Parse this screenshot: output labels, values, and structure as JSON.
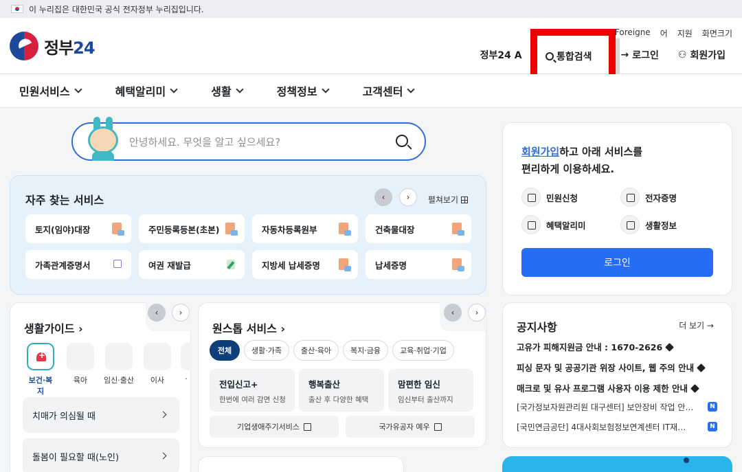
{
  "gov_banner": {
    "text": "이 누리집은 대한민국 공식 전자정부 누리집입니다."
  },
  "header": {
    "logo_prefix": "정부",
    "logo_num": "24",
    "util_top": [
      "For Foreigne",
      "어",
      "지원",
      "화면크기"
    ],
    "util_main": {
      "gov24": "정부24 A",
      "search": "통합검색",
      "login": "로그인",
      "signup": "회원가입"
    }
  },
  "nav": {
    "items": [
      "민원서비스",
      "혜택알리미",
      "생활",
      "정책정보",
      "고객센터"
    ]
  },
  "search": {
    "placeholder": "안녕하세요. 무엇을 알고 싶으세요?"
  },
  "frequent": {
    "title": "자주 찾는 서비스",
    "expand": "펼쳐보기",
    "items": [
      "토지(임야)대장",
      "주민등록등본(초본)",
      "자동차등록원부",
      "건축물대장",
      "가족관계증명서",
      "여권 재발급",
      "지방세 납세증명",
      "납세증명"
    ]
  },
  "life_guide": {
    "title": "생활가이드",
    "categories": [
      "보건·복지",
      "육아",
      "임신·출산",
      "이사",
      "·"
    ],
    "items": [
      "치매가 의심될 때",
      "돌봄이 필요할 때(노인)"
    ]
  },
  "onestop": {
    "title": "원스톱 서비스",
    "chips": [
      "전체",
      "생활·가족",
      "출산·육아",
      "복지·금융",
      "교육·취업·기업"
    ],
    "cards": [
      {
        "title": "전입신고+",
        "sub": "한번에 여러 감면 신청"
      },
      {
        "title": "행복출산",
        "sub": "출산 후 다양한 혜택"
      },
      {
        "title": "맘편한 임신",
        "sub": "임신부터 출산까지"
      }
    ],
    "links": [
      "기업생애주기서비스",
      "국가유공자 예우"
    ]
  },
  "login_card": {
    "link": "회원가입",
    "msg1": "하고 아래 서비스를",
    "msg2": "편리하게 이용하세요.",
    "quick": [
      "민원신청",
      "전자증명",
      "혜택알리미",
      "생활정보"
    ],
    "button": "로그인"
  },
  "notice": {
    "title": "공지사항",
    "more": "더 보기 →",
    "items": [
      "고유가 피해지원금 안내 : 1670-2626",
      "피싱 문자 및 공공기관 위장 사이트, 웹 주의 안내",
      "매크로 및 유사 프로그램 사용자 이용 제한 안내",
      "[국가정보자원관리원 대구센터] 보안장비 작업 안…",
      "[국민연금공단] 4대사회보험정보연계센터 IT재…"
    ],
    "badge": "N"
  },
  "colors": {
    "primary": "#256ef4",
    "highlight": "#ee0000",
    "navy": "#0e3f7a"
  },
  "icons": [
    "flag-icon",
    "search-icon",
    "chevron-down-icon",
    "login-icon",
    "user-plus-icon",
    "document-icon",
    "external-link-icon",
    "pin-icon"
  ]
}
